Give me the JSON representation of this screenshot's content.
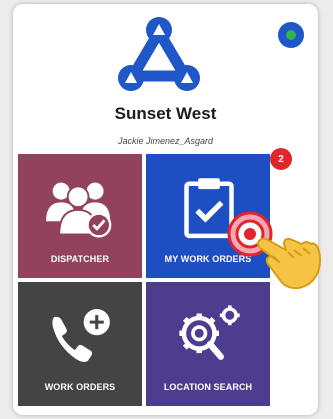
{
  "header": {
    "company_name": "Sunset West",
    "user_name": "Jackie Jimenez_Asgard",
    "logo_icon": "triangle-nodes-logo-icon",
    "status_icon": "status-dot-icon",
    "brand_color": "#1f57c9"
  },
  "tiles": [
    {
      "label": "DISPATCHER",
      "icon": "group-check-icon",
      "color": "#93425e"
    },
    {
      "label": "MY WORK ORDERS",
      "icon": "clipboard-check-icon",
      "color": "#1e4fc2",
      "badge": "2"
    },
    {
      "label": "WORK ORDERS",
      "icon": "phone-plus-icon",
      "color": "#444444"
    },
    {
      "label": "LOCATION SEARCH",
      "icon": "gear-search-icon",
      "color": "#4e3d8f"
    }
  ],
  "overlay": {
    "tap_icon": "tap-target-icon",
    "hand_icon": "pointing-hand-icon"
  }
}
